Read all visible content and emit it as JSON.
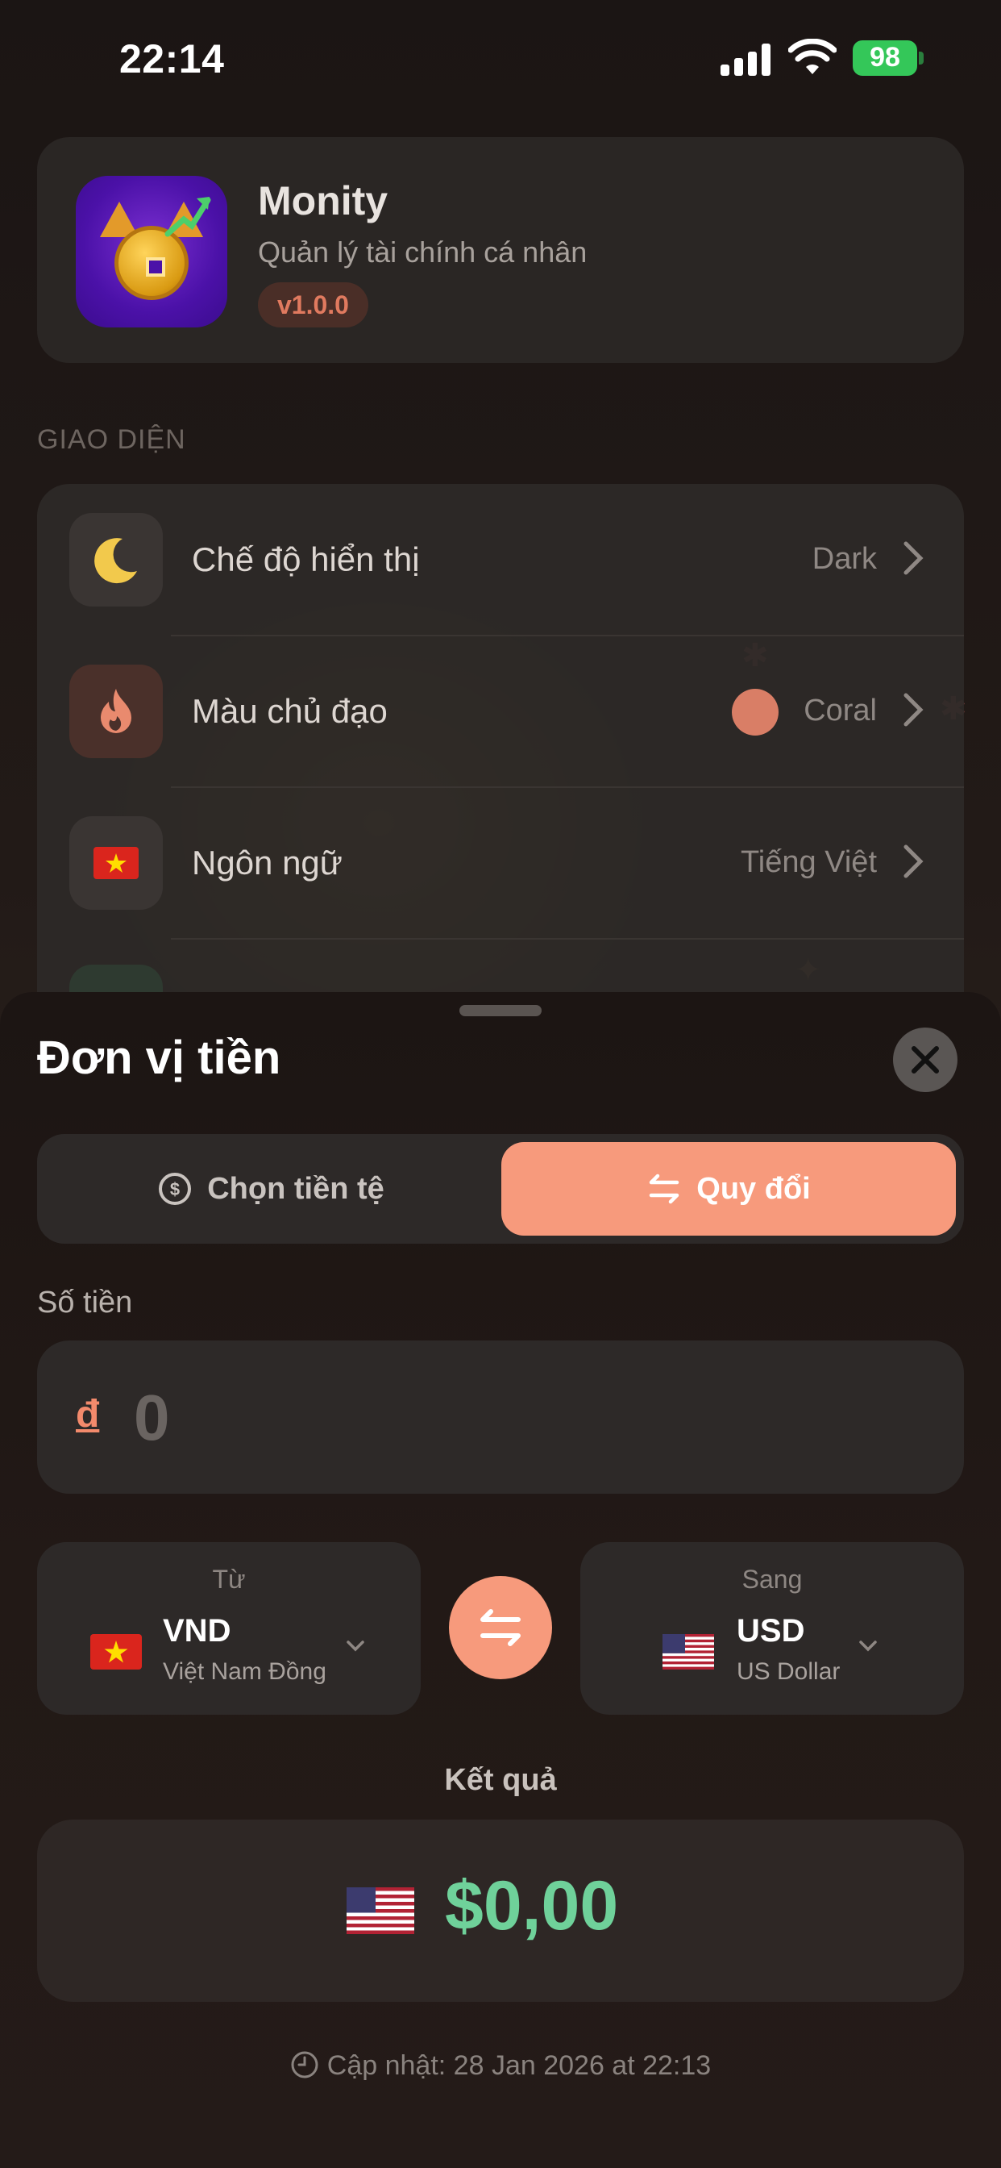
{
  "status_bar": {
    "time": "22:14",
    "battery": "98"
  },
  "app_info": {
    "name": "Monity",
    "description": "Quản lý tài chính cá nhân",
    "version": "v1.0.0"
  },
  "section": {
    "title": "GIAO DIỆN"
  },
  "settings": [
    {
      "label": "Chế độ hiển thị",
      "value": "Dark",
      "icon": "moon-icon"
    },
    {
      "label": "Màu chủ đạo",
      "value": "Coral",
      "icon": "flame-icon",
      "color": "#d97e66"
    },
    {
      "label": "Ngôn ngữ",
      "value": "Tiếng Việt",
      "icon": "vietnam-flag-icon"
    }
  ],
  "sheet": {
    "title": "Đơn vị tiền",
    "tabs": [
      {
        "label": "Chọn tiền tệ",
        "icon": "dollar-circle-icon",
        "active": false
      },
      {
        "label": "Quy đổi",
        "icon": "swap-arrows-icon",
        "active": true
      }
    ],
    "amount_label": "Số tiền",
    "amount_symbol": "đ",
    "amount_value": "0",
    "from": {
      "caption": "Từ",
      "code": "VND",
      "name": "Việt Nam Đồng",
      "flag": "vietnam-flag-icon"
    },
    "to": {
      "caption": "Sang",
      "code": "USD",
      "name": "US Dollar",
      "flag": "us-flag-icon"
    },
    "result_label": "Kết quả",
    "result_value": "$0,00",
    "updated": "Cập nhật: 28 Jan 2026 at 22:13"
  },
  "colors": {
    "accent": "#f79a7c",
    "result": "#6fd19a",
    "coral": "#d97e66",
    "battery": "#34c759"
  }
}
